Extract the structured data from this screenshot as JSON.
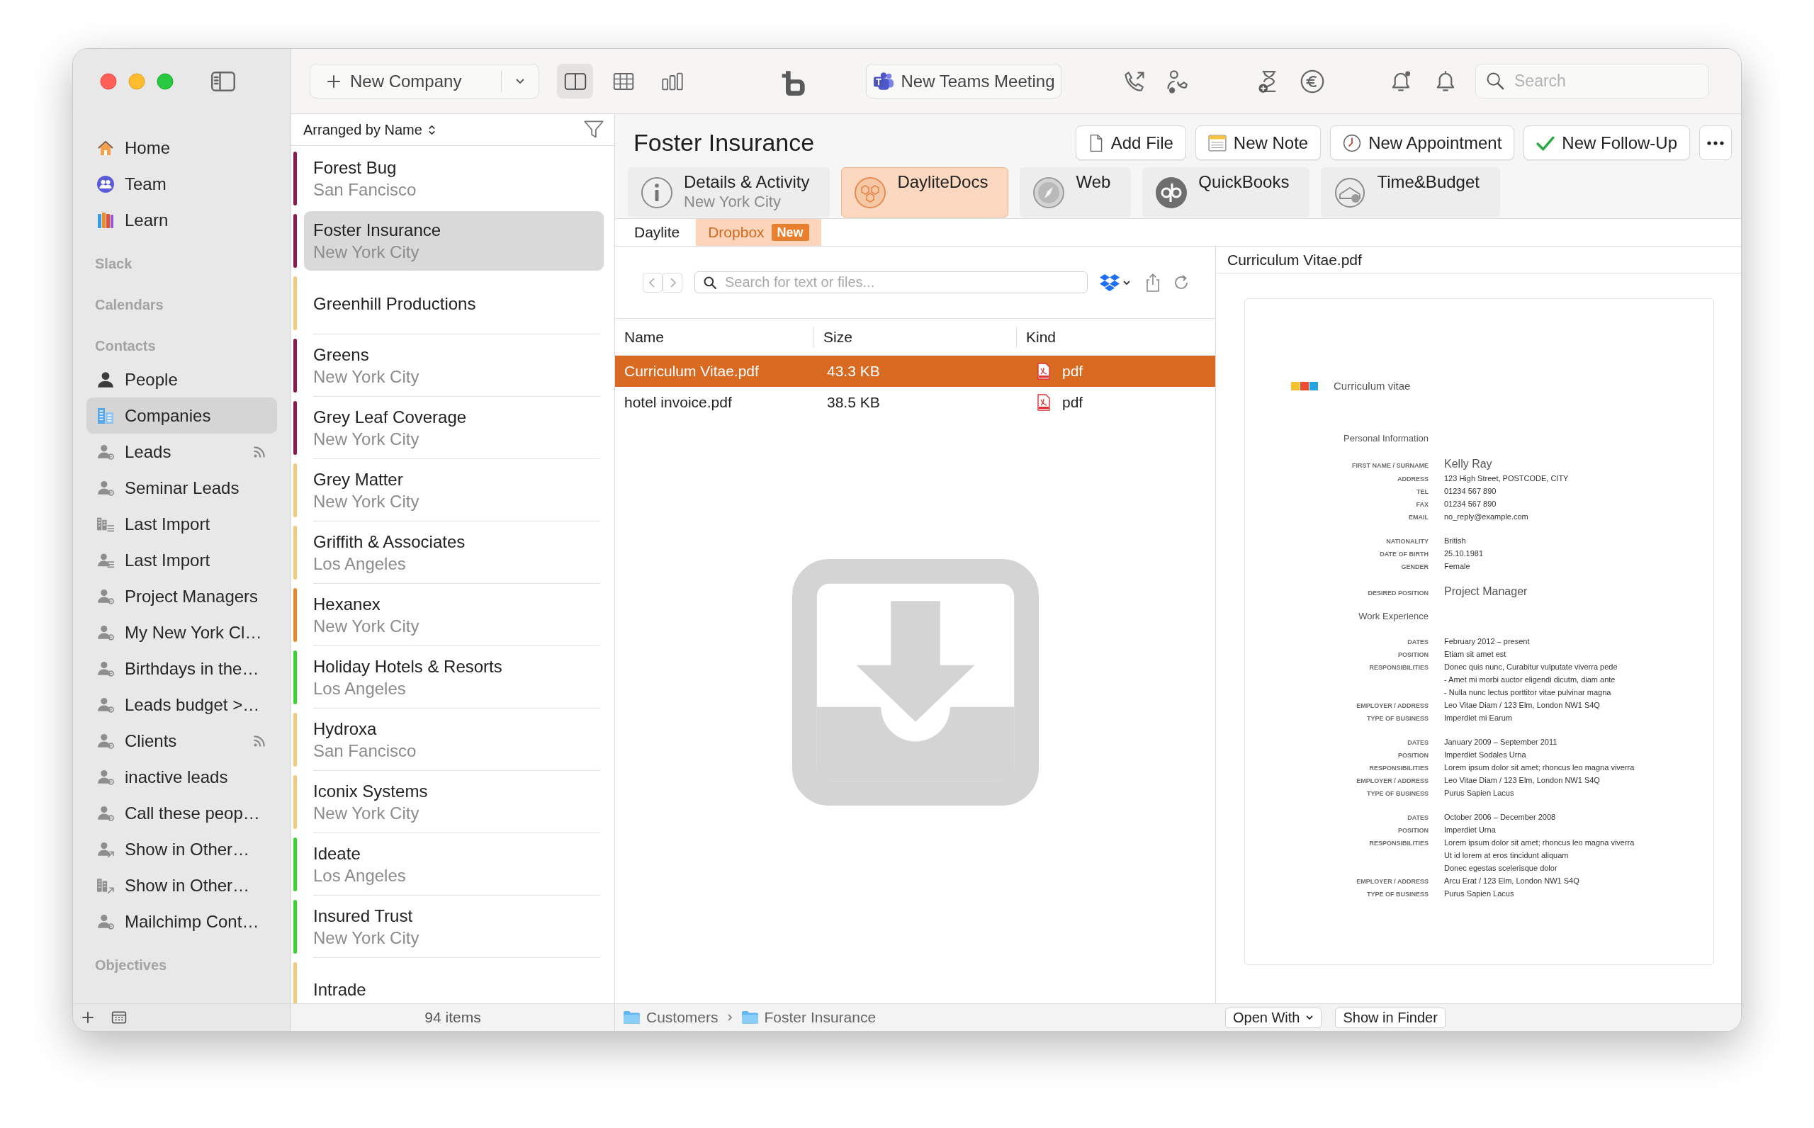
{
  "toolbar": {
    "new_company": "New Company",
    "teams_meeting": "New Teams Meeting",
    "search": {
      "placeholder": "Search"
    }
  },
  "sidebar": {
    "top_items": [
      {
        "label": "Home",
        "kind": "home",
        "selected": false
      },
      {
        "label": "Team",
        "kind": "team",
        "selected": false
      },
      {
        "label": "Learn",
        "kind": "learn",
        "selected": false
      }
    ],
    "sections": [
      {
        "title": "Slack"
      },
      {
        "title": "Calendars"
      },
      {
        "title": "Contacts",
        "items": [
          {
            "label": "People",
            "kind": "person",
            "selected": false,
            "shared": false
          },
          {
            "label": "Companies",
            "kind": "companies",
            "selected": true,
            "shared": false
          },
          {
            "label": "Leads",
            "kind": "smart-person",
            "selected": false,
            "shared": true
          },
          {
            "label": "Seminar Leads",
            "kind": "smart-person",
            "selected": false,
            "shared": false
          },
          {
            "label": "Last Import",
            "kind": "company-list",
            "selected": false,
            "shared": false
          },
          {
            "label": "Last Import",
            "kind": "person-list",
            "selected": false,
            "shared": false
          },
          {
            "label": "Project Managers",
            "kind": "smart-person",
            "selected": false,
            "shared": false
          },
          {
            "label": "My New York Cl…",
            "kind": "smart-person",
            "selected": false,
            "shared": false
          },
          {
            "label": "Birthdays in the…",
            "kind": "smart-person",
            "selected": false,
            "shared": false
          },
          {
            "label": "Leads budget >…",
            "kind": "smart-person",
            "selected": false,
            "shared": false
          },
          {
            "label": "Clients",
            "kind": "smart-person",
            "selected": false,
            "shared": true
          },
          {
            "label": "inactive leads",
            "kind": "smart-person",
            "selected": false,
            "shared": false
          },
          {
            "label": "Call these peop…",
            "kind": "smart-person",
            "selected": false,
            "shared": false
          },
          {
            "label": "Show in Other…",
            "kind": "person-link",
            "selected": false,
            "shared": false
          },
          {
            "label": "Show in Other…",
            "kind": "company-link",
            "selected": false,
            "shared": false
          },
          {
            "label": "Mailchimp Cont…",
            "kind": "smart-person",
            "selected": false,
            "shared": false
          }
        ]
      },
      {
        "title": "Objectives"
      }
    ]
  },
  "company_list": {
    "sort_label": "Arranged by Name",
    "count": "94 items",
    "rows": [
      {
        "name": "Forest Bug",
        "city": "San Fancisco",
        "color": "#8b1a4d",
        "selected": false
      },
      {
        "name": "Foster Insurance",
        "city": "New York City",
        "color": "#8b1a4d",
        "selected": true
      },
      {
        "name": "Greenhill Productions",
        "color": "#f2c97e",
        "selected": false
      },
      {
        "name": "Greens",
        "city": "New York City",
        "color": "#8b1a4d",
        "selected": false
      },
      {
        "name": "Grey Leaf Coverage",
        "city": "New York City",
        "color": "#8b1a4d",
        "selected": false
      },
      {
        "name": "Grey Matter",
        "city": "New York City",
        "color": "#f2c97e",
        "selected": false
      },
      {
        "name": "Griffith & Associates",
        "city": "Los Angeles",
        "color": "#f2c97e",
        "selected": false
      },
      {
        "name": "Hexanex",
        "city": "New York City",
        "color": "#ea862c",
        "selected": false
      },
      {
        "name": "Holiday Hotels & Resorts",
        "city": "Los Angeles",
        "color": "#35d72f",
        "selected": false
      },
      {
        "name": "Hydroxa",
        "city": "San Fancisco",
        "color": "#f2c97e",
        "selected": false
      },
      {
        "name": "Iconix Systems",
        "city": "New York City",
        "color": "#f2c97e",
        "selected": false
      },
      {
        "name": "Ideate",
        "city": "Los Angeles",
        "color": "#35d72f",
        "selected": false
      },
      {
        "name": "Insured Trust",
        "city": "New York City",
        "color": "#35d72f",
        "selected": false
      },
      {
        "name": "Intrade",
        "color": "#f2c97e",
        "selected": false
      }
    ]
  },
  "detail": {
    "title": "Foster Insurance",
    "actions": [
      {
        "label": "Add File",
        "kind": "file"
      },
      {
        "label": "New Note",
        "kind": "note"
      },
      {
        "label": "New Appointment",
        "kind": "appointment"
      },
      {
        "label": "New Follow-Up",
        "kind": "follow-up"
      }
    ],
    "tabs": [
      {
        "label": "Details & Activity",
        "sublabel": "New York City",
        "kind": "info",
        "selected": false
      },
      {
        "label": "DayliteDocs",
        "kind": "docs",
        "selected": true
      },
      {
        "label": "Web",
        "kind": "web",
        "selected": false
      },
      {
        "label": "QuickBooks",
        "kind": "quickbooks",
        "selected": false
      },
      {
        "label": "Time&Budget",
        "kind": "time",
        "selected": false
      }
    ],
    "subtabs": [
      {
        "label": "Daylite",
        "selected": false
      },
      {
        "label": "Dropbox",
        "badge": "New",
        "selected": true
      }
    ],
    "files": {
      "search": {
        "placeholder": "Search for text or files..."
      },
      "columns": [
        "Name",
        "Size",
        "Kind"
      ],
      "rows": [
        {
          "name": "Curriculum Vitae.pdf",
          "size": "43.3 KB",
          "type": "pdf",
          "selected": true
        },
        {
          "name": "hotel invoice.pdf",
          "size": "38.5 KB",
          "type": "pdf",
          "selected": false
        }
      ]
    },
    "breadcrumb": [
      "Customers",
      "Foster Insurance"
    ],
    "preview": {
      "title": "Curriculum Vitae.pdf",
      "buttons": [
        "Open With",
        "Show in Finder"
      ],
      "document": {
        "title": "Curriculum vitae",
        "blocks": [
          {
            "kind": "heading",
            "text": "Personal Information"
          },
          {
            "kind": "fields",
            "fields": [
              {
                "label": "FIRST NAME / SURNAME",
                "lines": [
                  "Kelly Ray"
                ],
                "large": true
              },
              {
                "label": "ADDRESS",
                "lines": [
                  "123 High Street, POSTCODE, CITY"
                ],
                "large": false
              },
              {
                "label": "TEL",
                "lines": [
                  "01234 567 890"
                ],
                "large": false
              },
              {
                "label": "FAX",
                "lines": [
                  "01234 567 890"
                ],
                "large": false
              },
              {
                "label": "EMAIL",
                "lines": [
                  "no_reply@example.com"
                ],
                "large": false
              }
            ]
          },
          {
            "kind": "fields",
            "fields": [
              {
                "label": "NATIONALITY",
                "lines": [
                  "British"
                ],
                "large": false
              },
              {
                "label": "DATE OF BIRTH",
                "lines": [
                  "25.10.1981"
                ],
                "large": false
              },
              {
                "label": "GENDER",
                "lines": [
                  "Female"
                ],
                "large": false
              }
            ]
          },
          {
            "kind": "fields",
            "fields": [
              {
                "label": "DESIRED POSITION",
                "lines": [
                  "Project Manager"
                ],
                "large": true
              }
            ]
          },
          {
            "kind": "heading",
            "text": "Work Experience"
          },
          {
            "kind": "fields",
            "fields": [
              {
                "label": "DATES",
                "lines": [
                  "February 2012 – present"
                ],
                "large": false
              },
              {
                "label": "POSITION",
                "lines": [
                  "Etiam sit amet est"
                ],
                "large": false
              },
              {
                "label": "RESPONSIBILITIES",
                "lines": [
                  "Donec quis nunc, Curabitur vulputate viverra pede",
                  "- Amet mi morbi auctor eligendi dicutm, diam ante",
                  "- Nulla nunc lectus porttitor vitae pulvinar magna"
                ],
                "large": false
              },
              {
                "label": "EMPLOYER / ADDRESS",
                "lines": [
                  "Leo Vitae Diam / 123 Elm, London NW1 S4Q"
                ],
                "large": false
              },
              {
                "label": "TYPE OF BUSINESS",
                "lines": [
                  "Imperdiet mi Earum"
                ],
                "large": false
              }
            ]
          },
          {
            "kind": "fields",
            "fields": [
              {
                "label": "DATES",
                "lines": [
                  "January 2009 – September 2011"
                ],
                "large": false
              },
              {
                "label": "POSITION",
                "lines": [
                  "Imperdiet Sodales Urna"
                ],
                "large": false
              },
              {
                "label": "RESPONSIBILITIES",
                "lines": [
                  "Lorem ipsum dolor sit amet; rhoncus leo magna viverra"
                ],
                "large": false
              },
              {
                "label": "EMPLOYER / ADDRESS",
                "lines": [
                  "Leo Vitae Diam / 123 Elm, London NW1 S4Q"
                ],
                "large": false
              },
              {
                "label": "TYPE OF BUSINESS",
                "lines": [
                  "Purus Sapien Lacus"
                ],
                "large": false
              }
            ]
          },
          {
            "kind": "fields",
            "fields": [
              {
                "label": "DATES",
                "lines": [
                  "October 2006 – December 2008"
                ],
                "large": false
              },
              {
                "label": "POSITION",
                "lines": [
                  "Imperdiet Urna"
                ],
                "large": false
              },
              {
                "label": "RESPONSIBILITIES",
                "lines": [
                  "Lorem ipsum dolor sit amet; rhoncus leo magna viverra",
                  "Ut id lorem at eros tincidunt aliquam",
                  "Donec egestas scelerisque dolor"
                ],
                "large": false
              },
              {
                "label": "EMPLOYER / ADDRESS",
                "lines": [
                  "Arcu Erat / 123 Elm, London NW1 S4Q"
                ],
                "large": false
              },
              {
                "label": "TYPE OF BUSINESS",
                "lines": [
                  "Purus Sapien Lacus"
                ],
                "large": false
              }
            ]
          }
        ]
      }
    }
  }
}
